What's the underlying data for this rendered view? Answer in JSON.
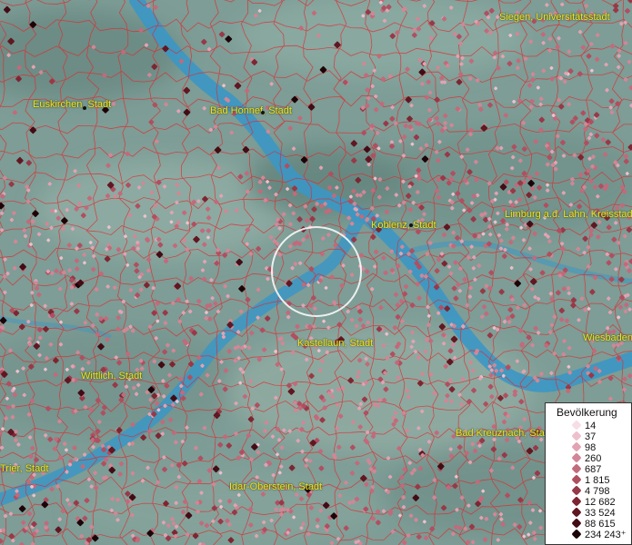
{
  "map": {
    "cities": [
      {
        "name": "Siegen, Universitätsstadt"
      },
      {
        "name": "Euskirchen, Stadt"
      },
      {
        "name": "Bad Honnef, Stadt"
      },
      {
        "name": "Koblenz, Stadt"
      },
      {
        "name": "Limburg a.d. Lahn, Kreisstadt"
      },
      {
        "name": "Kastellaun, Stadt"
      },
      {
        "name": "Wiesbaden"
      },
      {
        "name": "Wittlich, Stadt"
      },
      {
        "name": "Bad Kreuznach, Stadt"
      },
      {
        "name": "Trier, Stadt"
      },
      {
        "name": "Idar-Oberstein, Stadt"
      }
    ]
  },
  "legend": {
    "title": "Bevölkerung",
    "items": [
      {
        "label": "14",
        "color": "#f6dde6"
      },
      {
        "label": "37",
        "color": "#eec0cd"
      },
      {
        "label": "98",
        "color": "#e2a3b3"
      },
      {
        "label": "260",
        "color": "#d18796"
      },
      {
        "label": "687",
        "color": "#c26a7b"
      },
      {
        "label": "1 815",
        "color": "#b04f60"
      },
      {
        "label": "4 798",
        "color": "#983948"
      },
      {
        "label": "12 682",
        "color": "#7d2632"
      },
      {
        "label": "33 524",
        "color": "#611722"
      },
      {
        "label": "88 615",
        "color": "#430c15"
      },
      {
        "label": "234 243⁺",
        "color": "#1c0307"
      }
    ]
  },
  "colors": {
    "river": "#3b97c4",
    "boundary": "#e3272c",
    "label_text": "#f2e61c",
    "terrain": "#7f9f97"
  }
}
